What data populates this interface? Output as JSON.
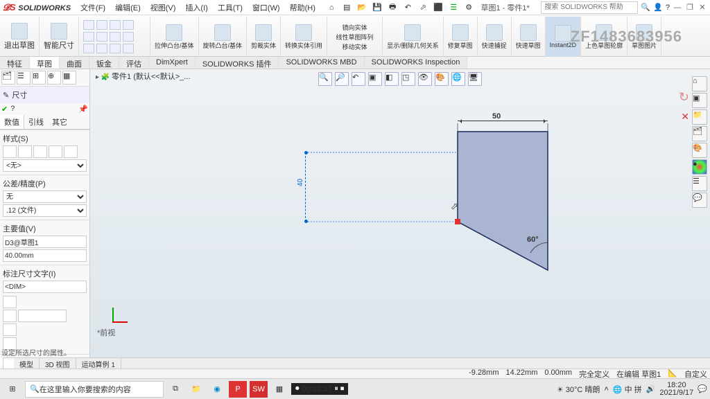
{
  "app": {
    "logo": "SOLIDWORKS",
    "doc_title": "草图1 - 零件1*",
    "search_placeholder": "搜索 SOLIDWORKS 帮助"
  },
  "menubar": [
    "文件(F)",
    "编辑(E)",
    "视图(V)",
    "插入(I)",
    "工具(T)",
    "窗口(W)",
    "帮助(H)"
  ],
  "watermark": "ZF1483683956",
  "ribbon": {
    "big_buttons": [
      {
        "label": "退出草图"
      },
      {
        "label": "智能尺寸"
      }
    ],
    "feature_buttons": [
      {
        "label": "拉伸凸台/基体"
      },
      {
        "label": "旋转凸台/基体"
      },
      {
        "label": "剪裁实体"
      },
      {
        "label": "转换实体引用"
      },
      {
        "label": "镜向实体"
      },
      {
        "label": "线性草图阵列"
      },
      {
        "label": "移动实体"
      }
    ],
    "right_buttons": [
      {
        "label": "显示/删除几何关系"
      },
      {
        "label": "修复草图"
      },
      {
        "label": "快速捕捉"
      },
      {
        "label": "快速草图"
      },
      {
        "label": "Instant2D"
      },
      {
        "label": "上色草图轮廓"
      },
      {
        "label": "草图图片"
      }
    ]
  },
  "tabs": [
    "特征",
    "草图",
    "曲面",
    "钣金",
    "评估",
    "DimXpert",
    "SOLIDWORKS 插件",
    "SOLIDWORKS MBD",
    "SOLIDWORKS Inspection"
  ],
  "active_tab": "草图",
  "breadcrumb": "零件1 (默认<<默认>_...",
  "prop_panel": {
    "title": "尺寸",
    "sub_tabs": [
      "数值",
      "引线",
      "其它"
    ],
    "style_label": "样式(S)",
    "style_select": "<无>",
    "tol_label": "公差/精度(P)",
    "tol_select1": "无",
    "tol_select2": ".12 (文件)",
    "primary_label": "主要值(V)",
    "primary_name": "D3@草图1",
    "primary_value": "40.00mm",
    "dimtext_label": "标注尺寸文字(I)",
    "dimtext_value": "<DIM>"
  },
  "sketch": {
    "dim_top": "50",
    "dim_left": "40",
    "angle": "60°"
  },
  "view_label": "*前视",
  "bottom_tabs": [
    "模型",
    "3D 视图",
    "运动算例 1"
  ],
  "statusbar": {
    "hint": "设定所选尺寸的属性。",
    "coord_x": "-9.28mm",
    "coord_y": "14.22mm",
    "coord_z": "0.00mm",
    "state": "完全定义",
    "context": "在编辑 草图1",
    "user": "自定义"
  },
  "taskbar": {
    "search_placeholder": "在这里输入你要搜索的内容",
    "timer": "00:02:37",
    "weather": "30°C 晴朗",
    "time": "18:20",
    "date": "2021/9/17"
  }
}
